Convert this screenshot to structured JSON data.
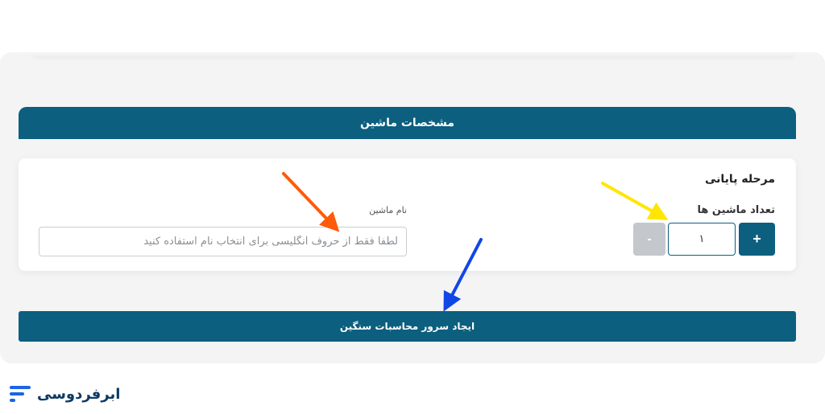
{
  "section": {
    "title": "مشخصات ماشین"
  },
  "form": {
    "stage_title": "مرحله پایانی",
    "machine_count_label": "تعداد ماشین ها",
    "machine_count_value": "۱",
    "plus_label": "+",
    "minus_label": "-",
    "machine_name_label": "نام ماشین",
    "machine_name_placeholder": "لطفا فقط از حروف انگلیسی برای انتخاب نام استفاده کنید"
  },
  "submit": {
    "label": "ایجاد سرور محاسبات سنگین"
  },
  "brand": {
    "name": "ابرفردوسی",
    "color": "#1c63e8"
  },
  "annotation_colors": {
    "orange": "#ff5a0a",
    "yellow": "#ffe600",
    "blue": "#1146e6"
  },
  "theme": {
    "primary": "#0c5f7e",
    "muted_button": "#c4c8cc",
    "panel_bg": "#f4f4f5"
  }
}
